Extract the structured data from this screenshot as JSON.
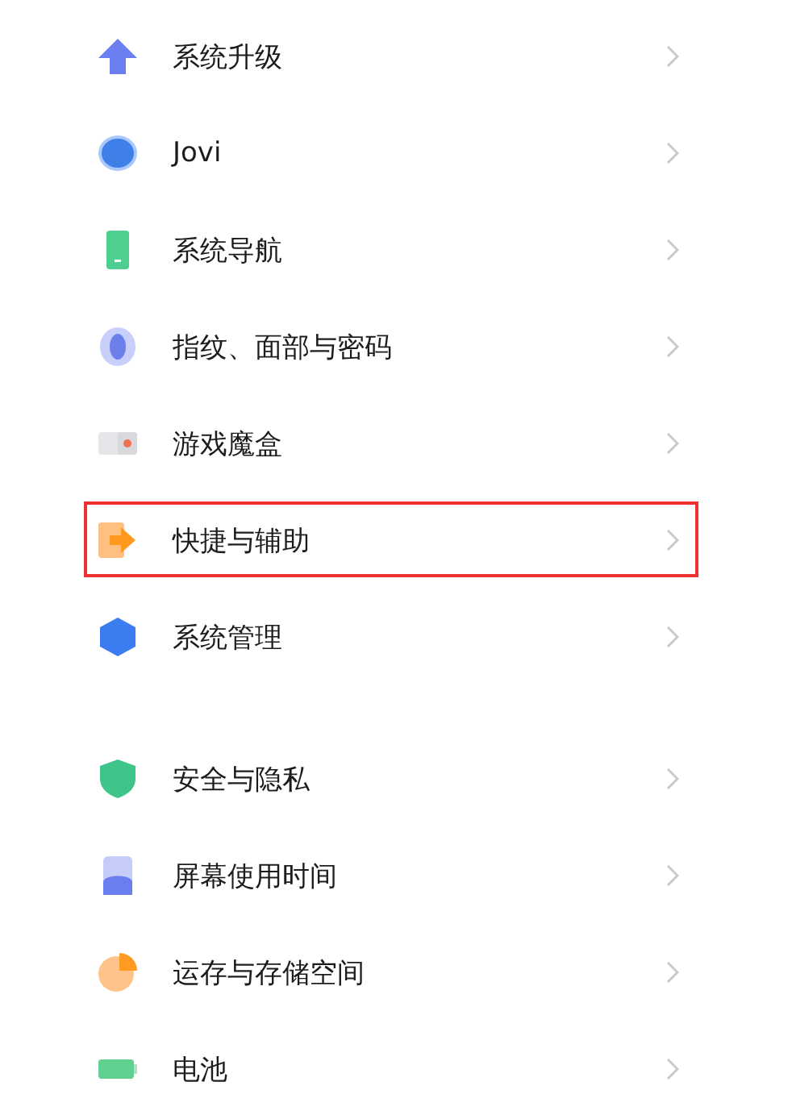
{
  "groups": [
    {
      "items": [
        {
          "kind": "upgrade",
          "label": "系统升级",
          "highlighted": false
        },
        {
          "kind": "jovi",
          "label": "Jovi",
          "highlighted": false
        },
        {
          "kind": "navigation",
          "label": "系统导航",
          "highlighted": false
        },
        {
          "kind": "fingerprint",
          "label": "指纹、面部与密码",
          "highlighted": false
        },
        {
          "kind": "gamebox",
          "label": "游戏魔盒",
          "highlighted": false
        },
        {
          "kind": "shortcut",
          "label": "快捷与辅助",
          "highlighted": true
        },
        {
          "kind": "manage",
          "label": "系统管理",
          "highlighted": false
        }
      ]
    },
    {
      "items": [
        {
          "kind": "security",
          "label": "安全与隐私",
          "highlighted": false
        },
        {
          "kind": "screentime",
          "label": "屏幕使用时间",
          "highlighted": false
        },
        {
          "kind": "storage",
          "label": "运存与存储空间",
          "highlighted": false
        },
        {
          "kind": "battery",
          "label": "电池",
          "highlighted": false
        }
      ]
    }
  ]
}
